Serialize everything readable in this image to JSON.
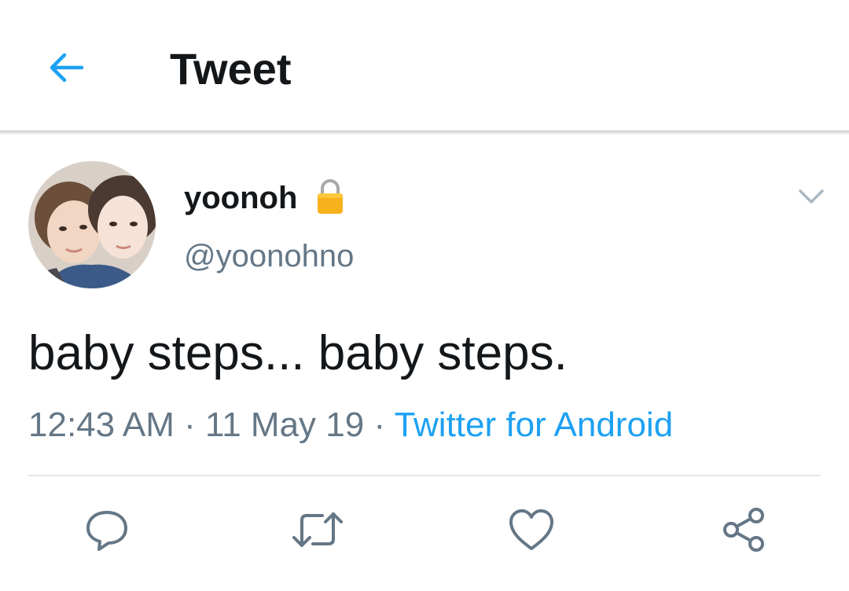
{
  "header": {
    "back_icon": "arrow-left-icon",
    "title": "Tweet"
  },
  "tweet": {
    "author": {
      "display_name": "yoonoh",
      "protected_icon": "lock-icon",
      "handle": "@yoonohno",
      "avatar": "avatar-photo"
    },
    "menu_icon": "chevron-down-icon",
    "text": "baby steps... baby steps.",
    "time": "12:43 AM",
    "separator": "·",
    "date": "11 May 19",
    "source": "Twitter for Android"
  },
  "actions": [
    {
      "icon": "reply-icon"
    },
    {
      "icon": "retweet-icon"
    },
    {
      "icon": "like-icon"
    },
    {
      "icon": "share-icon"
    }
  ],
  "colors": {
    "accent": "#1da1f2",
    "text_primary": "#14171a",
    "text_secondary": "#657786",
    "divider": "#e1e8ed"
  }
}
